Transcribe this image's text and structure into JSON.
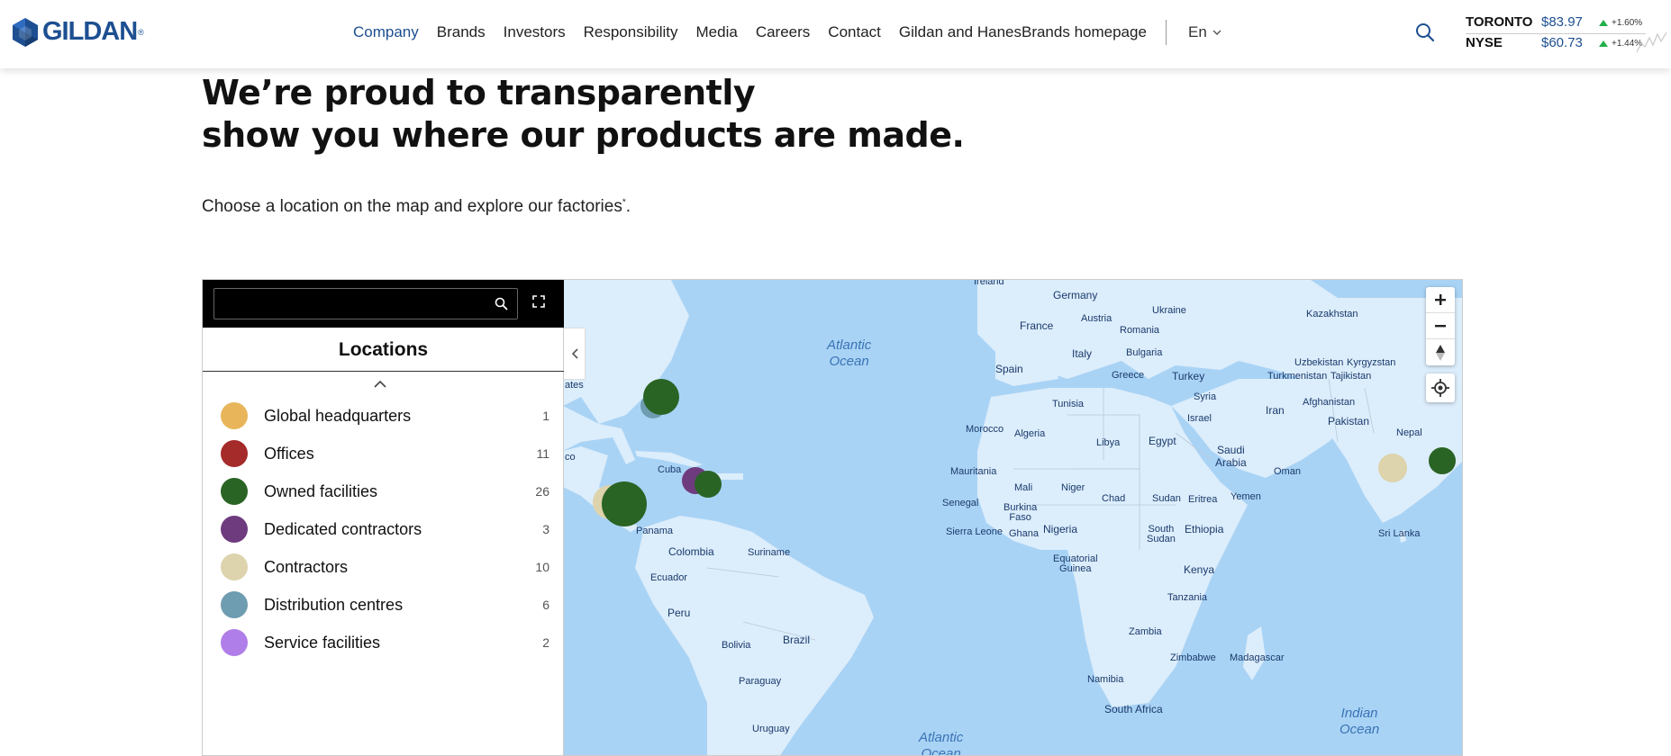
{
  "header": {
    "brand": "GILDAN",
    "nav": [
      {
        "label": "Company",
        "active": true
      },
      {
        "label": "Brands"
      },
      {
        "label": "Investors"
      },
      {
        "label": "Responsibility"
      },
      {
        "label": "Media"
      },
      {
        "label": "Careers"
      },
      {
        "label": "Contact"
      },
      {
        "label": "Gildan and HanesBrands homepage"
      }
    ],
    "language": "En",
    "stocks": [
      {
        "exchange": "TORONTO",
        "price": "$83.97",
        "change": "+1.60%"
      },
      {
        "exchange": "NYSE",
        "price": "$60.73",
        "change": "+1.44%"
      }
    ]
  },
  "page": {
    "headline_line1": "We’re proud to transparently",
    "headline_line2": "show you where our products are made.",
    "subtext": "Choose a location on the map and explore our factories",
    "subtext_mark": "*",
    "subtext_end": "."
  },
  "map": {
    "search_placeholder": "",
    "panel_title": "Locations",
    "legend": [
      {
        "label": "Global headquarters",
        "count": "1",
        "color": "#e8b55a"
      },
      {
        "label": "Offices",
        "count": "11",
        "color": "#a52a2a"
      },
      {
        "label": "Owned facilities",
        "count": "26",
        "color": "#2a6424"
      },
      {
        "label": "Dedicated contractors",
        "count": "3",
        "color": "#6e3b7e"
      },
      {
        "label": "Contractors",
        "count": "10",
        "color": "#ddd3ac"
      },
      {
        "label": "Distribution centres",
        "count": "6",
        "color": "#6e9cb0"
      },
      {
        "label": "Service facilities",
        "count": "2",
        "color": "#b07ee8"
      }
    ],
    "labels": {
      "ireland": "Ireland",
      "germany": "Germany",
      "ukraine": "Ukraine",
      "kazakhstan": "Kazakhstan",
      "france": "France",
      "austria": "Austria",
      "romania": "Romania",
      "spain": "Spain",
      "italy": "Italy",
      "bulgaria": "Bulgaria",
      "greece": "Greece",
      "turkey": "Turkey",
      "uzbekistan": "Uzbekistan",
      "kyrgyzstan": "Kyrgyzstan",
      "turkmenistan": "Turkmenistan",
      "tajikistan": "Tajikistan",
      "tunisia": "Tunisia",
      "syria": "Syria",
      "iran": "Iran",
      "afghanistan": "Afghanistan",
      "morocco": "Morocco",
      "algeria": "Algeria",
      "libya": "Libya",
      "egypt": "Egypt",
      "israel": "Israel",
      "pakistan": "Pakistan",
      "nepal": "Nepal",
      "saudi": "Saudi\nArabia",
      "oman": "Oman",
      "mauritania": "Mauritania",
      "mali": "Mali",
      "niger": "Niger",
      "chad": "Chad",
      "sudan": "Sudan",
      "eritrea": "Eritrea",
      "yemen": "Yemen",
      "senegal": "Senegal",
      "burkina": "Burkina\nFaso",
      "nigeria": "Nigeria",
      "sierra": "Sierra Leone",
      "ghana": "Ghana",
      "southsudan": "South\nSudan",
      "ethiopia": "Ethiopia",
      "eqguinea": "Equatorial\nGuinea",
      "kenya": "Kenya",
      "tanzania": "Tanzania",
      "zambia": "Zambia",
      "zimbabwe": "Zimbabwe",
      "madagascar": "Madagascar",
      "namibia": "Namibia",
      "southafrica": "South Africa",
      "srilanka": "Sri Lanka",
      "cuba": "Cuba",
      "panama": "Panama",
      "colombia": "Colombia",
      "suriname": "Suriname",
      "ecuador": "Ecuador",
      "peru": "Peru",
      "brazil": "Brazil",
      "bolivia": "Bolivia",
      "paraguay": "Paraguay",
      "uruguay": "Uruguay",
      "states": "ates",
      "mexico": "co",
      "atlantic_n": "Atlantic\nOcean",
      "atlantic_s": "Atlantic\nOcean",
      "indian": "Indian\nOcean"
    }
  }
}
